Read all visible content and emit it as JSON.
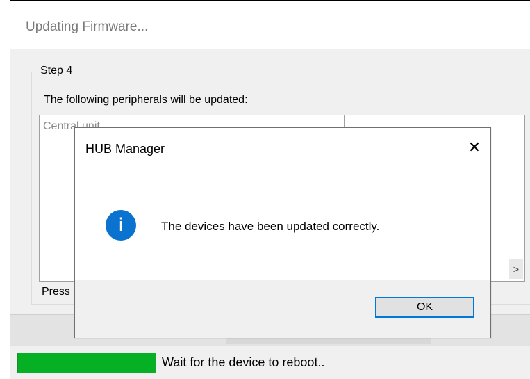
{
  "window": {
    "title": "Updating Firmware...",
    "step_label": "Step 4",
    "peripherals_label": "The following peripherals will be updated:",
    "left_list_item": "Central unit",
    "right_list_item": ".",
    "scroll_right_glyph": ">",
    "press_text": "Press"
  },
  "status": {
    "progress_fraction": 1.0,
    "text": "Wait for the device to reboot..",
    "progress_color": "#06b025"
  },
  "dialog": {
    "title": "HUB Manager",
    "close_glyph": "✕",
    "icon": "info-icon",
    "icon_glyph": "i",
    "message": "The devices have been updated correctly.",
    "ok_label": "OK",
    "accent_color": "#0078d7"
  }
}
